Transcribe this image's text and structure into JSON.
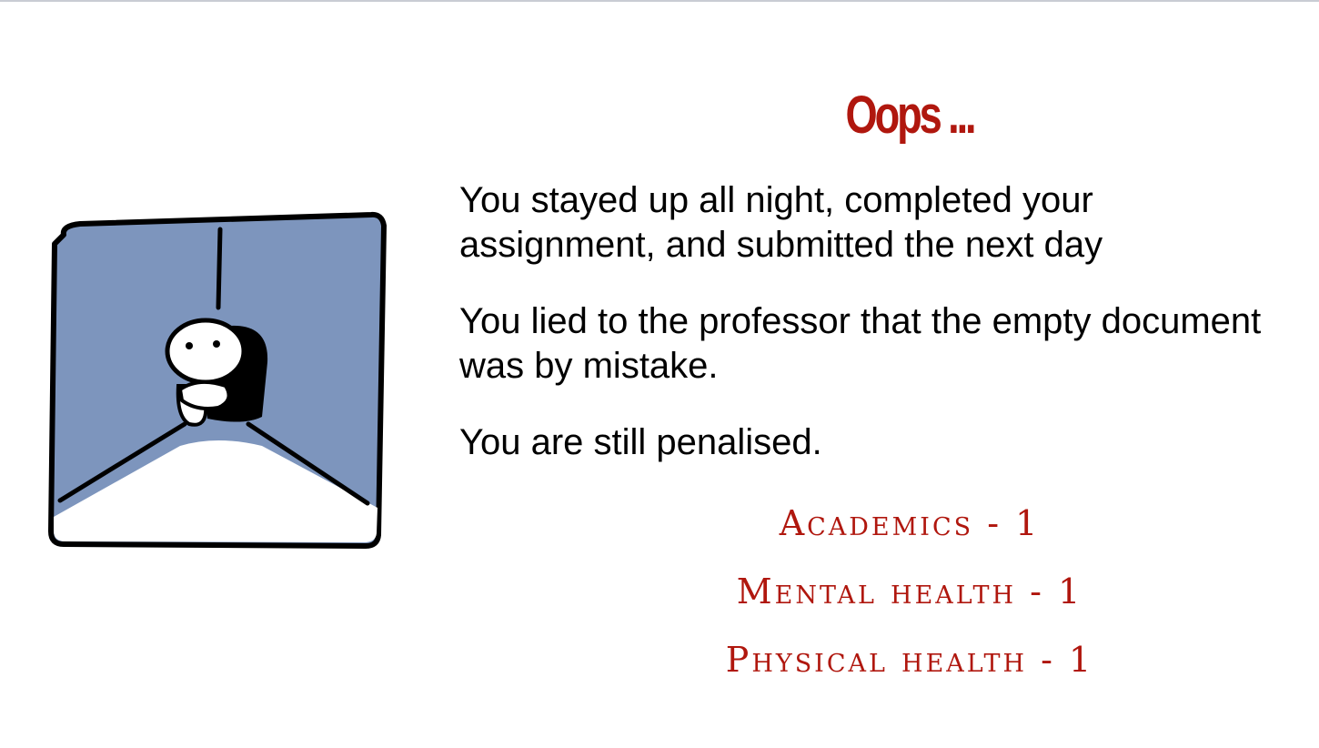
{
  "slide": {
    "title": "Oops ...",
    "paragraphs": [
      "You stayed up all night, completed your assignment, and submitted the next day",
      "You lied to the professor that the empty document was by mistake.",
      "You are still penalised."
    ],
    "stats": [
      "Academics - 1",
      "Mental health - 1",
      "Physical health - 1"
    ]
  },
  "colors": {
    "accent": "#b0170e",
    "panel_blue": "#7d95bd",
    "text": "#000000"
  },
  "icons": {
    "illustration": "sad-person-hugging-knees-in-corner"
  }
}
